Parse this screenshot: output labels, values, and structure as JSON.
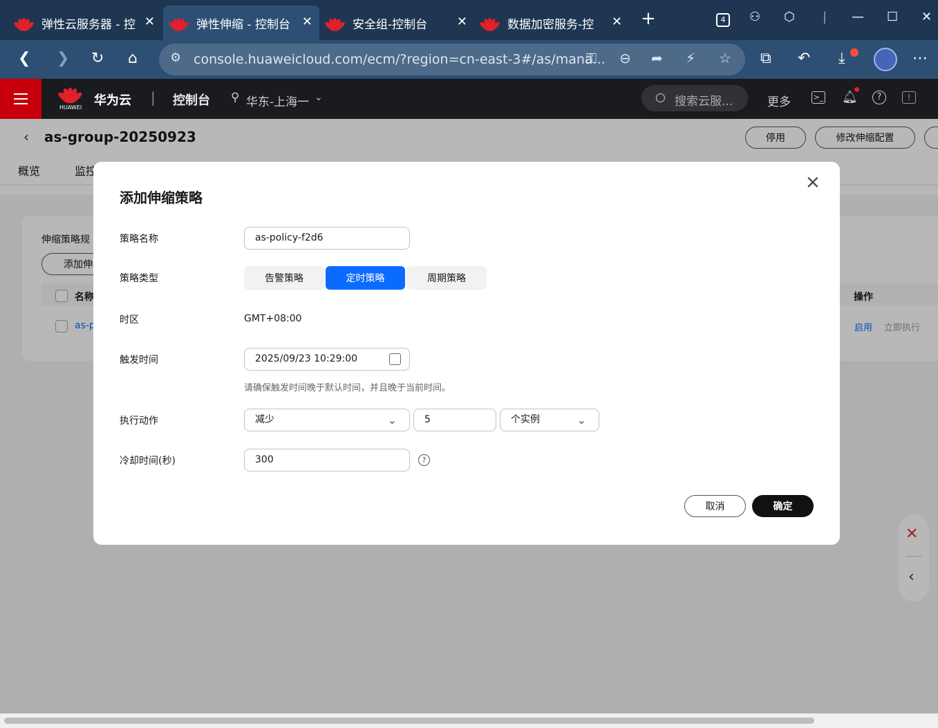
{
  "browser": {
    "tabs": [
      {
        "title": "弹性云服务器 - 控"
      },
      {
        "title": "弹性伸缩 - 控制台"
      },
      {
        "title": "安全组-控制台"
      },
      {
        "title": "数据加密服务-控"
      }
    ],
    "tab_count_badge": "4",
    "url": "console.huaweicloud.com/ecm/?region=cn-east-3#/as/mana..."
  },
  "console": {
    "brand": "华为云",
    "brand_sub": "HUAWEI",
    "console_label": "控制台",
    "region": "华东-上海一",
    "search_placeholder": "搜索云服...",
    "more": "更多"
  },
  "page": {
    "group_title": "as-group-20250923",
    "actions": [
      "停用",
      "修改伸缩配置"
    ],
    "tabs": [
      "概览",
      "监控"
    ],
    "section_title": "伸缩策略规",
    "add_button": "添加伸缩",
    "table": {
      "col_name": "名称",
      "col_ops": "操作",
      "row_name": "as-p",
      "row_ops": [
        "启用",
        "立即执行"
      ]
    }
  },
  "modal": {
    "title": "添加伸缩策略",
    "fields": {
      "name_label": "策略名称",
      "name_value": "as-policy-f2d6",
      "type_label": "策略类型",
      "types": [
        "告警策略",
        "定时策略",
        "周期策略"
      ],
      "timezone_label": "时区",
      "timezone_value": "GMT+08:00",
      "trigger_label": "触发时间",
      "trigger_value": "2025/09/23 10:29:00",
      "trigger_hint": "请确保触发时间晚于默认时间，并且晚于当前时间。",
      "action_label": "执行动作",
      "action_value": "减少",
      "action_count": "5",
      "action_unit": "个实例",
      "cooldown_label": "冷却时间(秒)",
      "cooldown_value": "300"
    },
    "cancel": "取消",
    "confirm": "确定"
  },
  "colors": {
    "primary": "#0c6bff",
    "brand_red": "#c7000b",
    "tabbar": "#1f3652"
  }
}
